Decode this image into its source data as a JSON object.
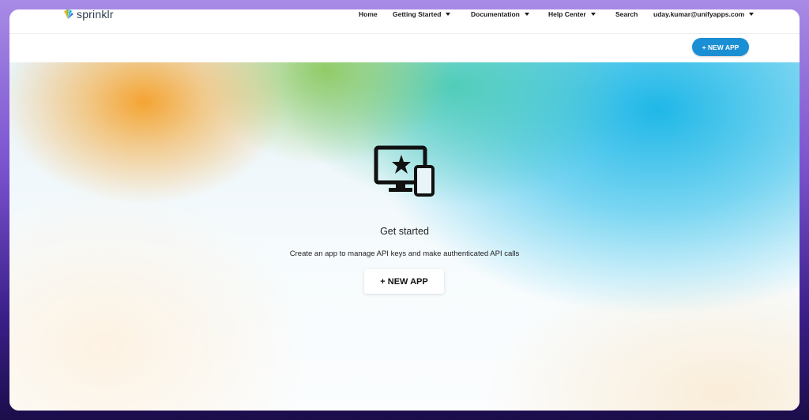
{
  "brand": {
    "name": "sprinklr",
    "logo_colors": [
      "#f7a823",
      "#7bc043",
      "#1fb3e6",
      "#3f6fd8"
    ]
  },
  "nav": {
    "items": [
      {
        "label": "Home",
        "has_dropdown": false
      },
      {
        "label": "Getting Started",
        "has_dropdown": true
      },
      {
        "label": "Documentation",
        "has_dropdown": true
      },
      {
        "label": "Help Center",
        "has_dropdown": true
      },
      {
        "label": "Search",
        "has_dropdown": false
      },
      {
        "label": "uday.kumar@unifyapps.com",
        "has_dropdown": true
      }
    ]
  },
  "toolbar": {
    "new_app_label": "+ NEW APP",
    "accent": "#1b8fd4"
  },
  "empty_state": {
    "icon": "devices-star-icon",
    "title": "Get started",
    "description": "Create an app to manage API keys and make authenticated API calls",
    "button_label": "+ NEW APP"
  }
}
